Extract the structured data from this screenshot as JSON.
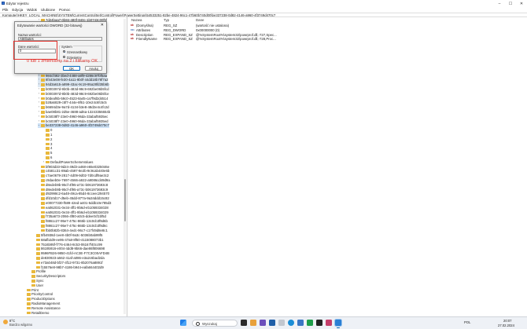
{
  "window": {
    "title": "Edytor rejestru"
  },
  "window_buttons": [
    "–",
    "☐",
    "✕"
  ],
  "menu": [
    "Plik",
    "Edycja",
    "Widok",
    "Ulubione",
    "Pomoc"
  ],
  "address": "Komputer\\HKEY_LOCAL_MACHINE\\SYSTEM\\CurrentControlSet\\Control\\Power\\PowerSettings\\54533251-82be-4824-96c1-47b60b740d00\\be337238-0d82-4146-a960-4f3749d470c7",
  "tree": {
    "top_items": [
      {
        "label": "7d24baa7-0b84-480f-840c-1b0743c00f5f",
        "expander": "›"
      }
    ],
    "mid_items": [
      {
        "label": "984cf492-3bed-4488-a8f9-4286c97bf5aa",
        "expander": "›"
      },
      {
        "label": "8f443e08-fe30-4a11-9b0f-44dd18b78f7a2",
        "expander": "›"
      },
      {
        "label": "94d3a615-a899-43ac-9c19-95a28fd35b6b",
        "expander": "›"
      },
      {
        "label": "b000397d-9b0b-483d-98c9-692be06b5fcd",
        "expander": "›"
      },
      {
        "label": "b000397d-9b0b-483d-98c9-692be06b5fce",
        "expander": "›"
      },
      {
        "label": "b0deaf6b-59c0-4523-8a45-ca7f9d2d4514",
        "expander": "›"
      },
      {
        "label": "b28a6829-c5f7-444e-8f61-10e24c6fc5c5",
        "expander": "›"
      },
      {
        "label": "b6694d3e-9a7d-4134-b3e8-48d2e4c4fc2d",
        "expander": "›"
      },
      {
        "label": "bae08b81-2d5e-4688-ad6a-13243356654b",
        "expander": "›"
      },
      {
        "label": "bc5038f7-23e0-4960-96da-33abaf5935ec",
        "expander": "›"
      },
      {
        "label": "bc5038f7-23e0-4960-96da-33abaf5935ed",
        "expander": "›"
      },
      {
        "label": "be337238-0d82-4146-a960-4f3749d470c7",
        "expander": "⌄",
        "selected": true
      }
    ],
    "children": [
      {
        "label": "0"
      },
      {
        "label": "1"
      },
      {
        "label": "2"
      },
      {
        "label": "3"
      },
      {
        "label": "4"
      },
      {
        "label": "5"
      },
      {
        "label": "6"
      },
      {
        "label": "DefaultPowerSchemeValues",
        "expander": "›"
      }
    ],
    "siblings": [
      {
        "label": "bf903d33-9d24-49d3-a468-e65e0325046e"
      },
      {
        "label": "c4581c31-89ab-4597-8e2b-9c9cab440e6b"
      },
      {
        "label": "c7ae0679-2817-4d09-9d02-7d0cdf9ae3c2"
      },
      {
        "label": "c9daeb0e-7697-4566-a922-a9086cd49d9a"
      },
      {
        "label": "d8edeb9b-95cf-4f95-a73c-b061973693c8"
      },
      {
        "label": "d8edeb9b-95cf-4f95-a73c-b061973693c9"
      },
      {
        "label": "d92998c2-6a48-49ca-85d4-8cceec294570"
      },
      {
        "label": "dfd10d17-d5eb-45dd-877a-9a34ddd15c82"
      },
      {
        "label": "e00077330-f589-42ed-a401-5ddb10e785d3"
      },
      {
        "label": "ea062031-0e34-4ff1-9b6d-eb1059334028"
      },
      {
        "label": "ea062031-0e34-4ff1-9b6d-eb1059334029"
      },
      {
        "label": "f735a673-2066-4f80-a0c5-ddee0cf1bf5d"
      },
      {
        "label": "f8861c27-95e7-475c-865b-13c0cb3f9d6b"
      },
      {
        "label": "f8861c27-95e7-475c-865b-13c0cb3f9d6c"
      },
      {
        "label": "fbb0b82b-8364-4edc-96c7-c17f49d8e8c1"
      }
    ],
    "more_items": [
      {
        "label": "5fb4938d-1ee8-4b0f-9a3c-5036b0ab99f5"
      },
      {
        "label": "68afb2d9-ee95-47a8-8f50-4115088073b1"
      },
      {
        "label": "7516b95f-f776-4464-8c53-06167f40cc99"
      },
      {
        "label": "8619b916-e004-4dd8-9b66-dae86f806698"
      },
      {
        "label": "9596FB26-9850-41fd-AC3E-F7C3C00AFD4B"
      },
      {
        "label": "de830923-a562-41af-a086-e3a2c6bad2da"
      },
      {
        "label": "e73a048d-bf27-4f12-9731-8b2076a8891f"
      },
      {
        "label": "f15576e8-98b7-4186-b944-eafa664402d9"
      }
    ],
    "bottom_items": [
      {
        "label": "Profile",
        "indent": 2
      },
      {
        "label": "SecurityDescriptors",
        "indent": 2
      },
      {
        "label": "Sync",
        "indent": 2
      },
      {
        "label": "User",
        "indent": 2
      },
      {
        "label": "Print",
        "indent": 1
      },
      {
        "label": "PriorityControl",
        "indent": 1
      },
      {
        "label": "ProductOptions",
        "indent": 1
      },
      {
        "label": "RadioManagement",
        "indent": 1
      },
      {
        "label": "Remote Assistance",
        "indent": 1
      },
      {
        "label": "RetailDemo",
        "indent": 1
      }
    ]
  },
  "values_list": {
    "headers": [
      "Nazwa",
      "Typ",
      "Dane"
    ],
    "rows": [
      {
        "name": "(Domyślna)",
        "type": "REG_SZ",
        "data": "(wartość nie ustalona)",
        "icon": "ab"
      },
      {
        "name": "Attributes",
        "type": "REG_DWORD",
        "data": "0x00000000 (0)",
        "icon": "bin"
      },
      {
        "name": "Description",
        "type": "REG_EXPAND_SZ",
        "data": "@%SystemRoot%\\system32\\powrprof.dll,-727,Spec...",
        "icon": "ab"
      },
      {
        "name": "FriendlyName",
        "type": "REG_EXPAND_SZ",
        "data": "@%SystemRoot%\\system32\\powrprof.dll,-728,Proc...",
        "icon": "ab"
      }
    ]
  },
  "dialog": {
    "title": "Edytowanie wartości DWORD (32-bitowej)",
    "close": "✕",
    "name_label": "Nazwa wartości:",
    "name_value": "Attributes",
    "data_label": "Dane wartości:",
    "data_value": "0",
    "base_label": "System",
    "base_options": [
      {
        "label": "Szesnastkowy",
        "selected": true
      },
      {
        "label": "Dziesiętny",
        "selected": false
      }
    ],
    "ok": "OK",
    "cancel": "Anuluj"
  },
  "annotation": {
    "text": "0 lub 1 zmieniamy na 2 i klikamy OK",
    "color": "#e3342f"
  },
  "taskbar": {
    "weather_temp": "8°C",
    "weather_desc": "Bardzo wilgotno",
    "search_placeholder": "Wyszukaj",
    "tray_lang": "POL",
    "time": "20:07",
    "date": "27.02.2024"
  }
}
